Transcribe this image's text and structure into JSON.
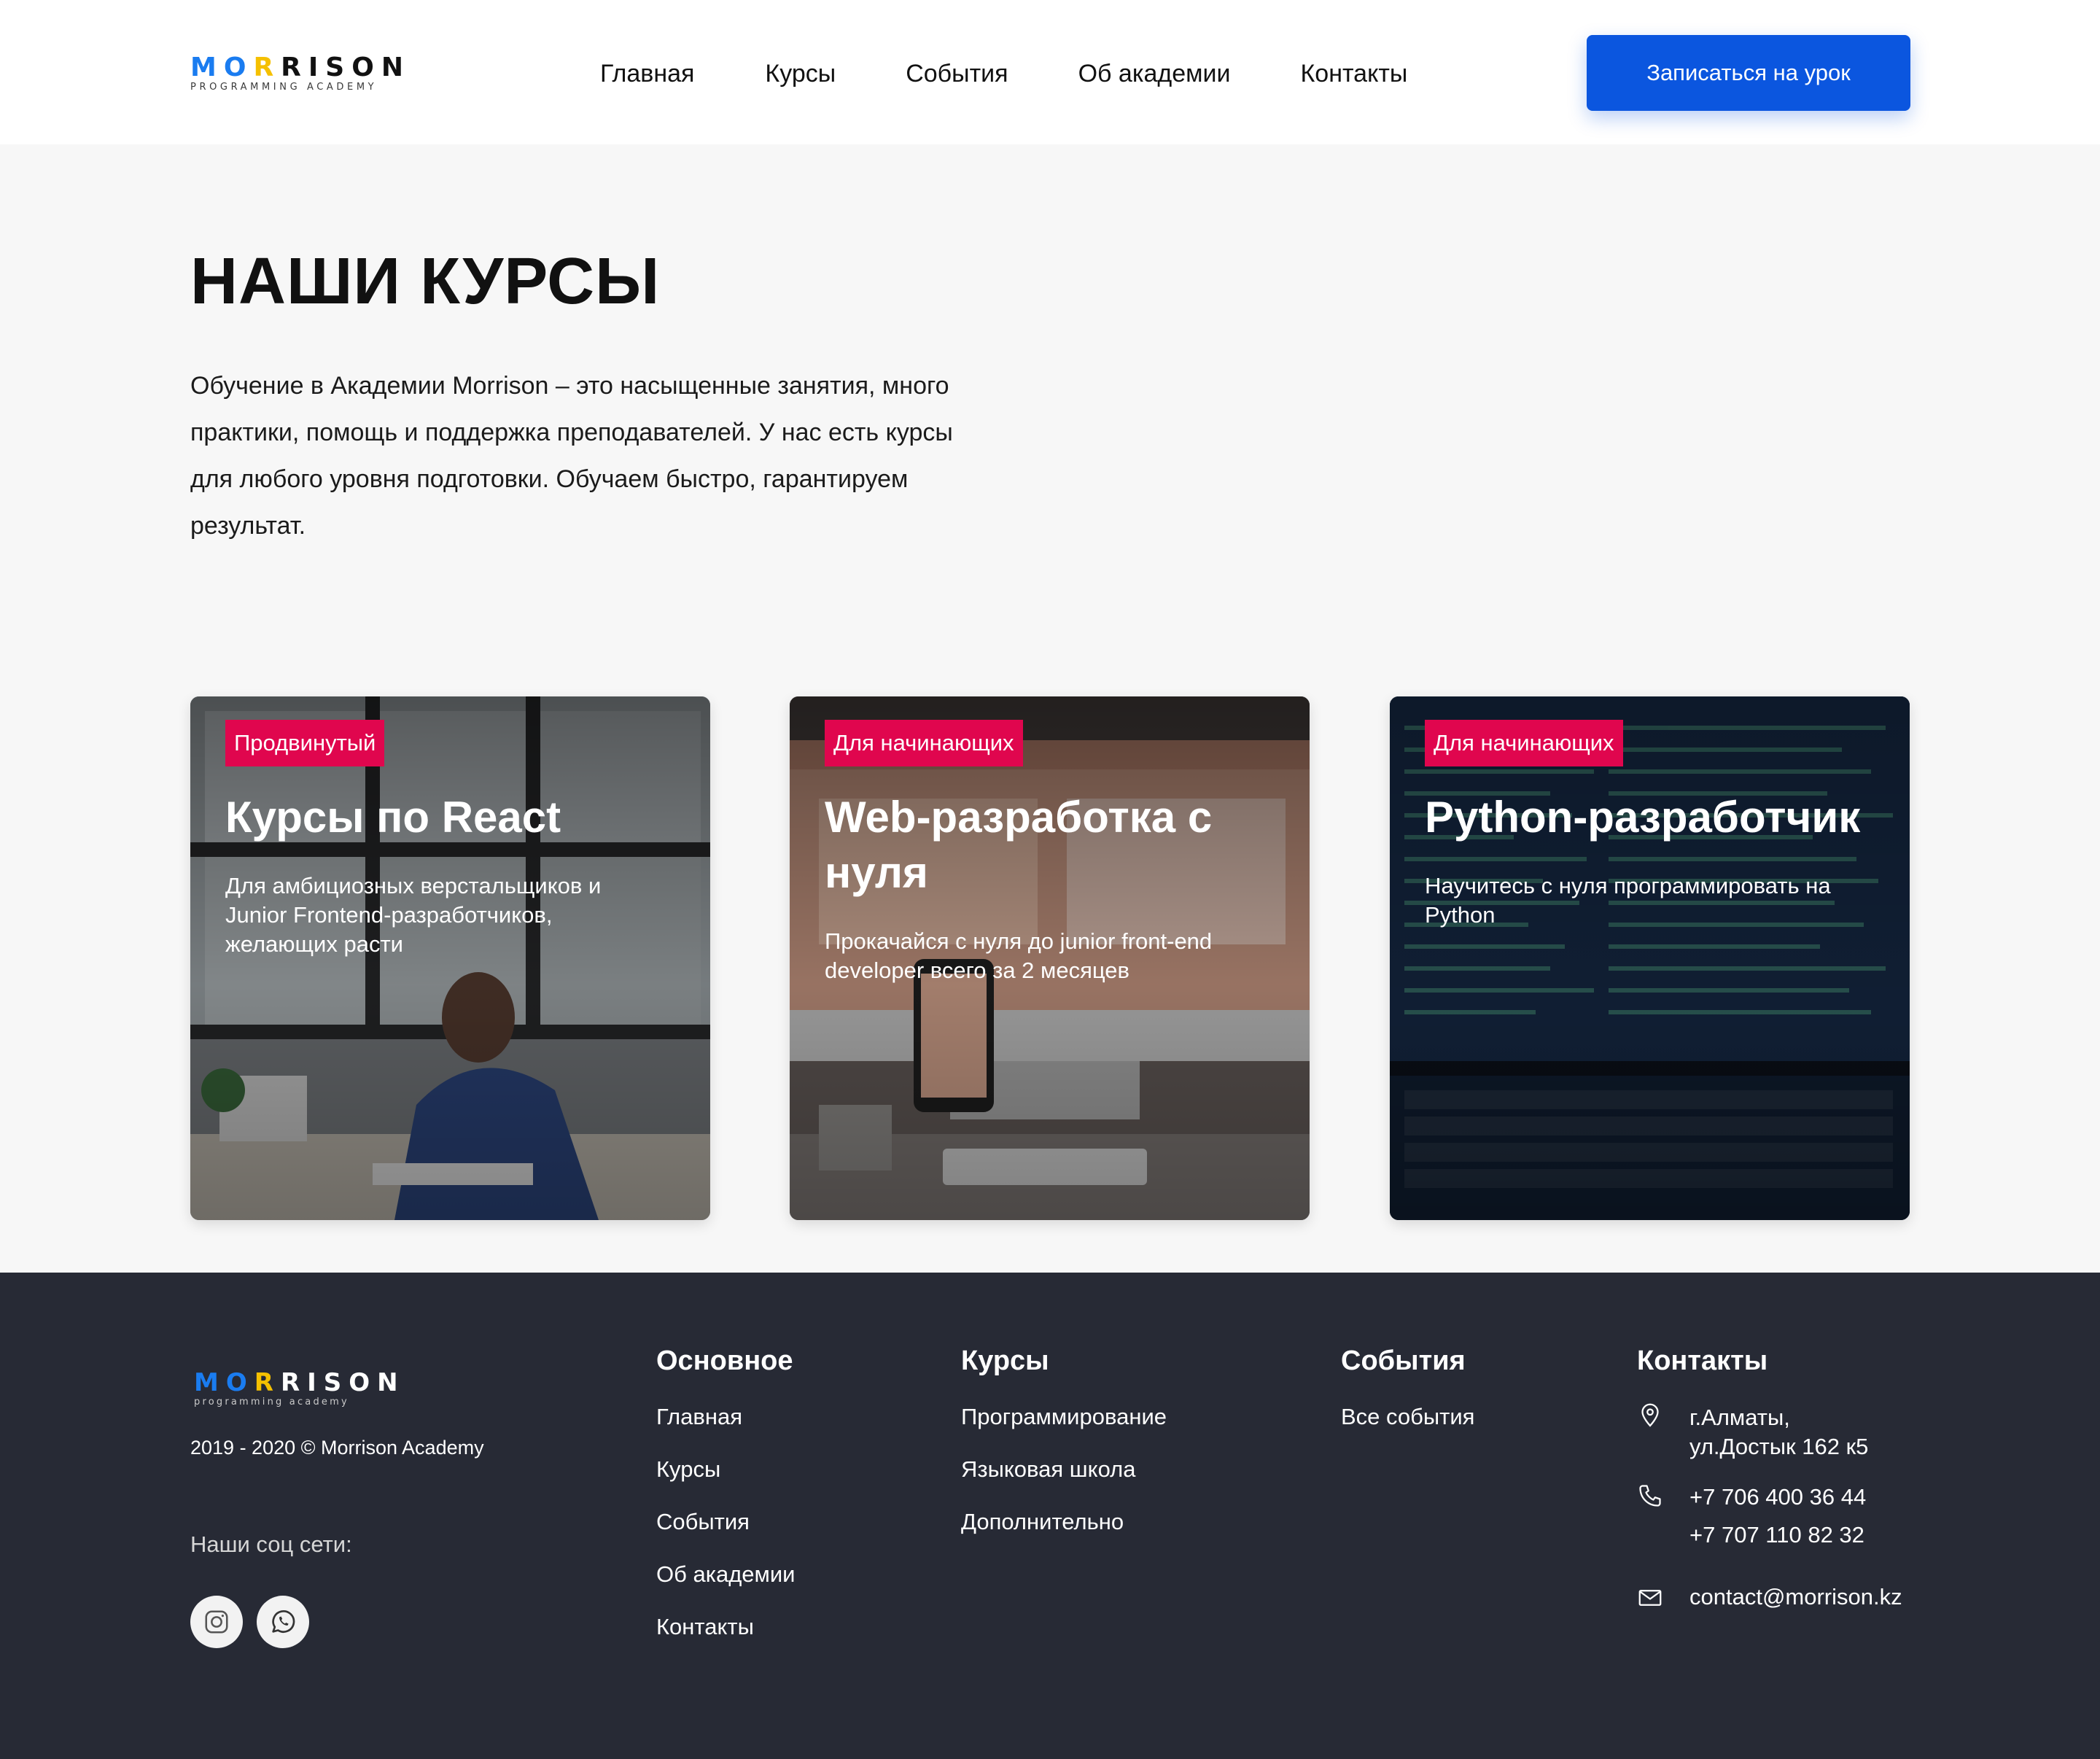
{
  "header": {
    "logo_parts": [
      "MO",
      "R",
      "RISON"
    ],
    "logo_sub": "PROGRAMMING ACADEMY",
    "nav": [
      "Главная",
      "Курсы",
      "События",
      "Об академии",
      "Контакты"
    ],
    "cta_label": "Записаться на урок"
  },
  "intro": {
    "title": "НАШИ КУРСЫ",
    "lines": [
      "Обучение в Академии Morrison – это насыщенные занятия, много",
      "практики, помощь и поддержка преподавателей. У нас есть курсы",
      "для любого уровня подготовки. Обучаем быстро, гарантируем",
      "результат."
    ]
  },
  "courses": [
    {
      "badge": "Продвинутый",
      "title": "Курсы по React",
      "desc_lines": [
        "Для амбициозных верстальщиков и",
        "Junior Frontend-разработчиков,",
        "желающих расти"
      ]
    },
    {
      "badge": "Для начинающих",
      "title_lines": [
        "Web-разработка с",
        "нуля"
      ],
      "desc_lines": [
        "Прокачайся с нуля до junior front-end",
        "developer всего за 2 месяцев"
      ]
    },
    {
      "badge": "Для начинающих",
      "title": "Python-разработчик",
      "desc_lines": [
        "Научитесь с нуля программировать на",
        "Python"
      ]
    }
  ],
  "footer": {
    "logo_parts": [
      "MO",
      "R",
      "RISON"
    ],
    "logo_sub": "programming academy",
    "copyright": "2019 - 2020 © Morrison Academy",
    "social_label": "Наши соц сети:",
    "social_icons": [
      "instagram-icon",
      "whatsapp-icon"
    ],
    "main_title": "Основное",
    "main_links": [
      "Главная",
      "Курсы",
      "События",
      "Об академии",
      "Контакты"
    ],
    "courses_title": "Курсы",
    "courses_links": [
      "Программирование",
      "Языковая школа",
      "Дополнительно"
    ],
    "events_title": "События",
    "events_links": [
      "Все события"
    ],
    "contacts_title": "Контакты",
    "address_lines": [
      "г.Алматы,",
      "ул.Достык 162 к5"
    ],
    "phones": [
      "+7 706 400 36 44",
      "+7 707 110 82 32"
    ],
    "email": "contact@morrison.kz"
  },
  "colors": {
    "accent_blue": "#0b56df",
    "badge_red": "#e0064e",
    "logo_blue": "#1a7cf0",
    "logo_yellow": "#f5c000",
    "footer_bg": "#272a35"
  }
}
